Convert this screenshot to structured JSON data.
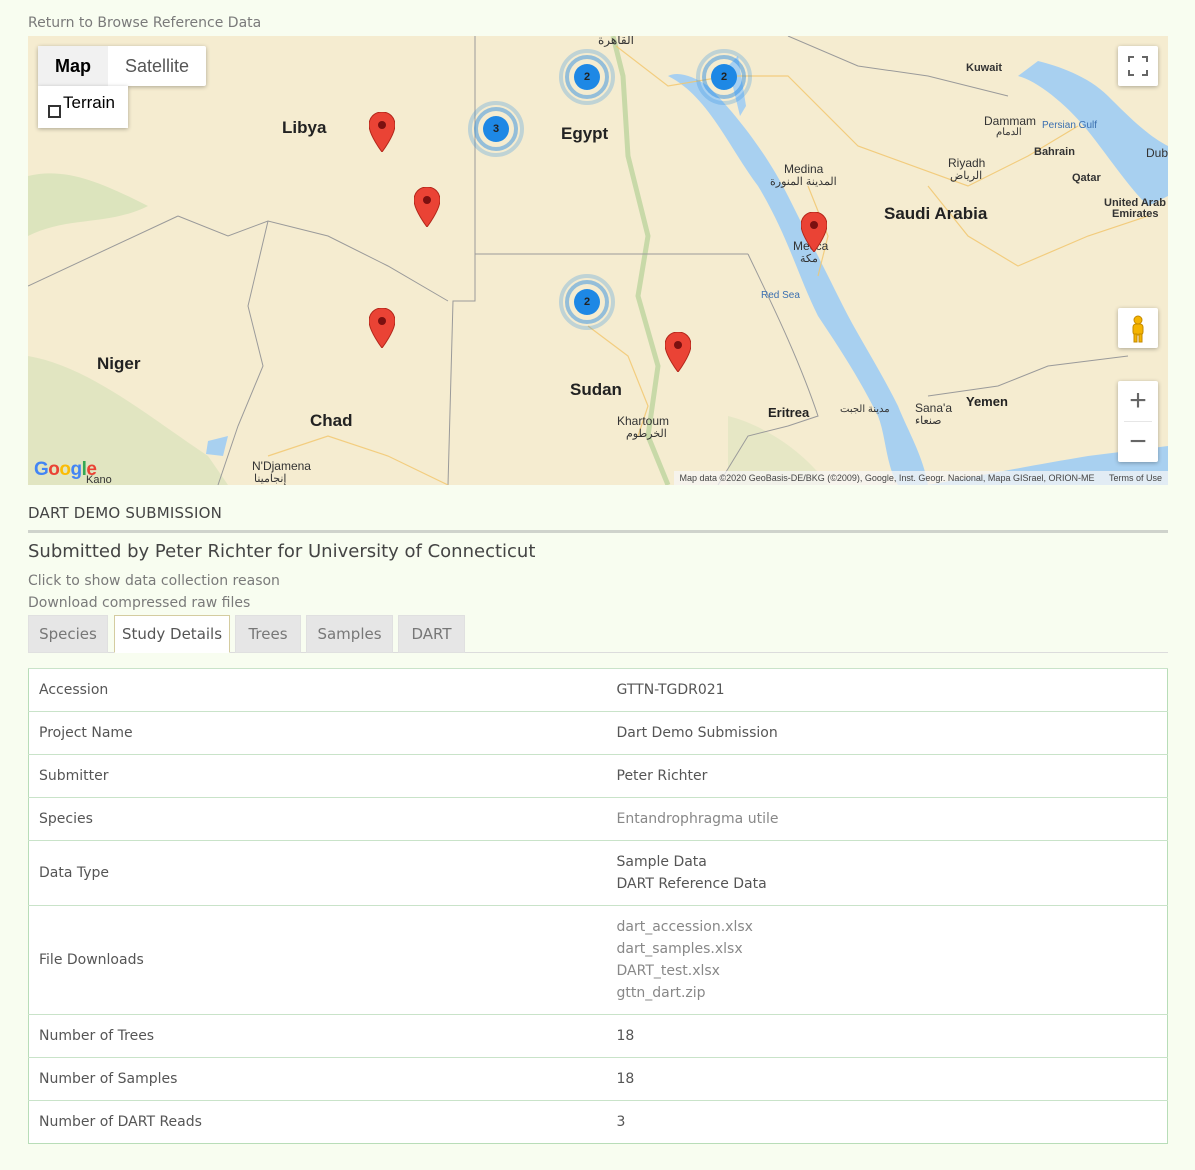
{
  "nav": {
    "return_link": "Return to Browse Reference Data"
  },
  "map": {
    "map_type": {
      "map": "Map",
      "satellite": "Satellite"
    },
    "terrain_label": "Terrain",
    "labels": {
      "libya": "Libya",
      "egypt": "Egypt",
      "niger": "Niger",
      "chad": "Chad",
      "sudan": "Sudan",
      "saudi_arabia": "Saudi Arabia",
      "yemen": "Yemen",
      "eritrea": "Eritrea",
      "cairo": "القاهرة",
      "kuwait": "Kuwait",
      "dammam": "Dammam",
      "dammam_ar": "الدمام",
      "persian_gulf": "Persian Gulf",
      "bahrain": "Bahrain",
      "dubai": "Dub",
      "medina": "Medina",
      "medina_ar": "المدينة المنورة",
      "riyadh": "Riyadh",
      "riyadh_ar": "الرياض",
      "qatar": "Qatar",
      "uae": "United Arab",
      "uae2": "Emirates",
      "mecca": "Mecca",
      "mecca_ar": "مكة",
      "red_sea": "Red Sea",
      "khartoum": "Khartoum",
      "khartoum_ar": "الخرطوم",
      "ndjamena": "N'Djamena",
      "ndjamena_ar": "إنجامينا",
      "kano": "Kano",
      "sanaa": "Sana'a",
      "sanaa_ar": "صنعاء",
      "jeddah_ar": "مدينة الجبت"
    },
    "clusters": [
      {
        "count": "2"
      },
      {
        "count": "2"
      },
      {
        "count": "3"
      },
      {
        "count": "2"
      }
    ],
    "google": "Google",
    "attribution": "Map data ©2020 GeoBasis-DE/BKG (©2009), Google, Inst. Geogr. Nacional, Mapa GISrael, ORION-ME",
    "terms": "Terms of Use",
    "zoom_in": "+",
    "zoom_out": "−"
  },
  "submission": {
    "title": "DART DEMO SUBMISSION",
    "submitted_by": "Submitted by Peter Richter for University of Connecticut",
    "collection_reason_link": "Click to show data collection reason",
    "download_link": "Download compressed raw files"
  },
  "tabs": [
    "Species",
    "Study Details",
    "Trees",
    "Samples",
    "DART"
  ],
  "active_tab": "Study Details",
  "details": {
    "accession": {
      "label": "Accession",
      "value": "GTTN-TGDR021"
    },
    "project_name": {
      "label": "Project Name",
      "value": "Dart Demo Submission"
    },
    "submitter": {
      "label": "Submitter",
      "value": "Peter Richter"
    },
    "species": {
      "label": "Species",
      "value": "Entandrophragma utile"
    },
    "data_type": {
      "label": "Data Type",
      "values": [
        "Sample Data",
        "DART Reference Data"
      ]
    },
    "file_downloads": {
      "label": "File Downloads",
      "files": [
        "dart_accession.xlsx",
        "dart_samples.xlsx",
        "DART_test.xlsx",
        "gttn_dart.zip"
      ]
    },
    "num_trees": {
      "label": "Number of Trees",
      "value": "18"
    },
    "num_samples": {
      "label": "Number of Samples",
      "value": "18"
    },
    "num_dart_reads": {
      "label": "Number of DART Reads",
      "value": "3"
    }
  },
  "colors": {
    "marker": "#ea4335",
    "cluster": "#1e88e5",
    "water": "#a8d0f0",
    "land": "#f5ecd0"
  }
}
